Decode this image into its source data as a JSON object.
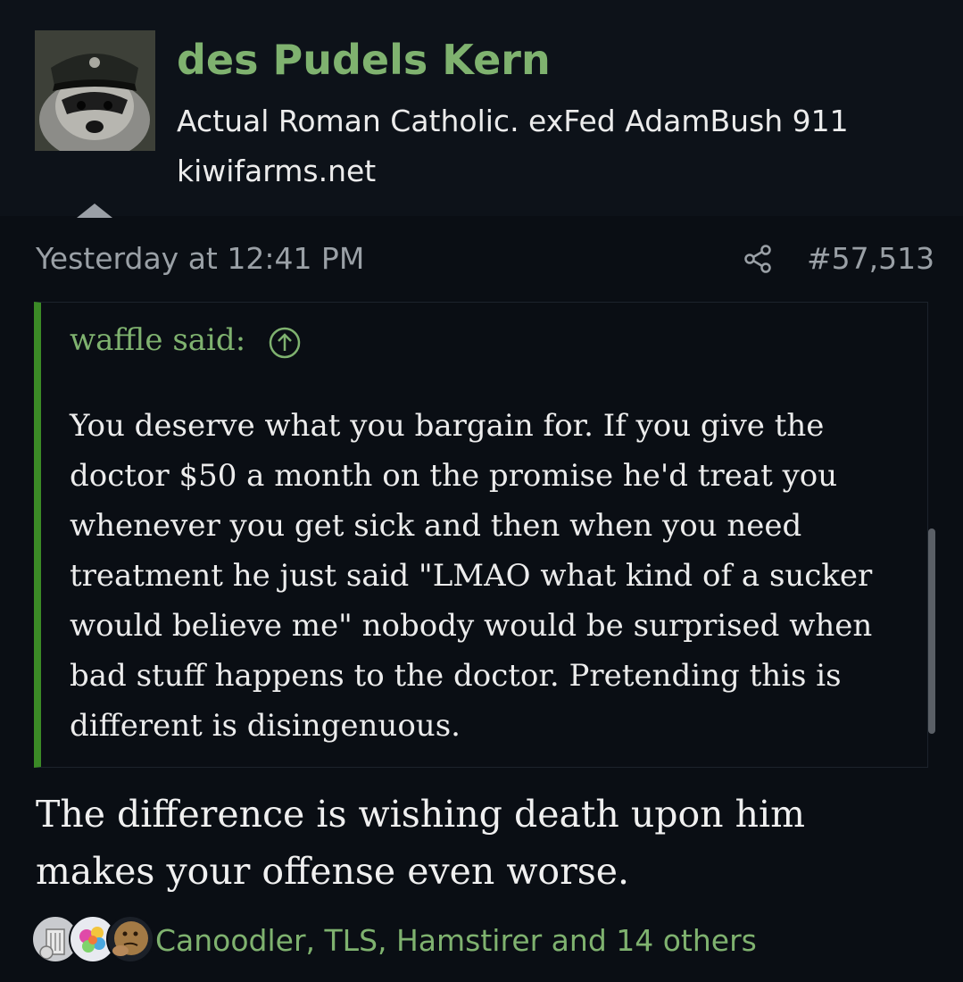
{
  "post": {
    "username": "des Pudels Kern",
    "user_title": "Actual Roman Catholic. exFed AdamBush 911",
    "user_site": "kiwifarms.net",
    "timestamp": "Yesterday at 12:41 PM",
    "post_number": "#57,513"
  },
  "quote": {
    "author": "waffle said:",
    "body": "You deserve what you bargain for. If you give the doctor $50 a month on the promise he'd treat you whenever you get sick and then when you need treatment he just said \"LMAO what kind of a sucker would believe me\" nobody would be surprised when bad stuff happens to the doctor. Pretending this is different is disingenuous."
  },
  "reply": {
    "body": "The difference is wishing death upon him makes your offense even worse."
  },
  "reactions": {
    "summary": "Canoodler, TLS, Hamstirer and 14 others",
    "icons": [
      "trash-can-icon",
      "colorful-flower-icon",
      "thinking-face-icon"
    ]
  },
  "colors": {
    "accent": "#7fb26f",
    "quote_border": "#3b8a26",
    "background": "#0a0e14",
    "muted": "#9aa0a6"
  }
}
